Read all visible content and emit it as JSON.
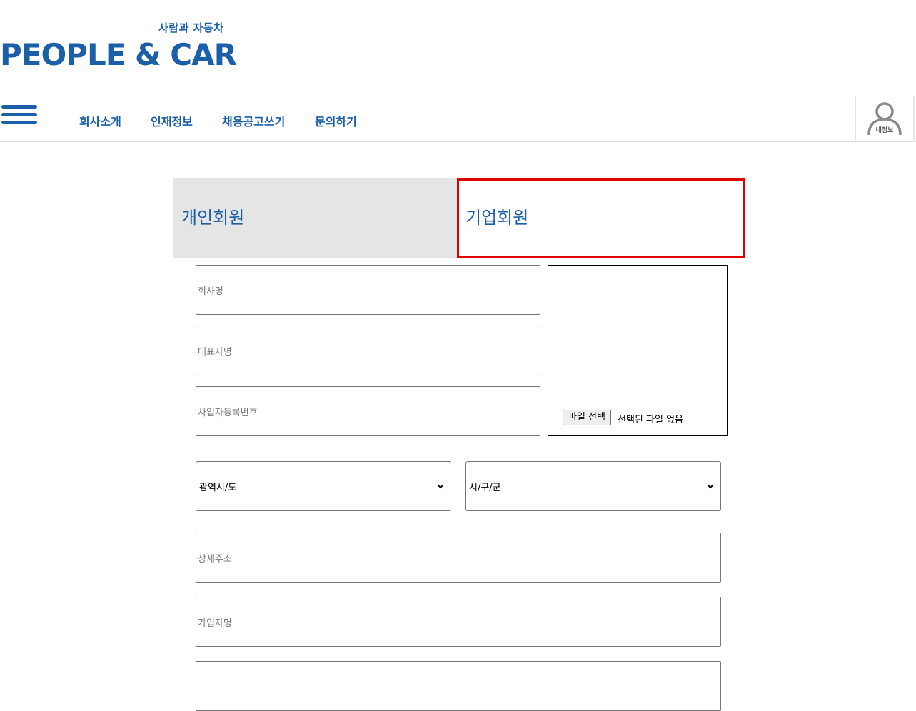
{
  "logo": {
    "tagline": "사람과 자동차",
    "name": "PEOPLE & CAR"
  },
  "nav": {
    "items": [
      {
        "label": "회사소개"
      },
      {
        "label": "인재정보"
      },
      {
        "label": "채용공고쓰기"
      },
      {
        "label": "문의하기"
      }
    ],
    "my_info_label": "내정보"
  },
  "tabs": {
    "personal": "개인회원",
    "company": "기업회원"
  },
  "form": {
    "company_name_placeholder": "회사명",
    "ceo_name_placeholder": "대표자명",
    "business_number_placeholder": "사업자등록번호",
    "file_button_label": "파일 선택",
    "file_status": "선택된 파일 없음",
    "province_select": "광역시/도",
    "city_select": "시/구/군",
    "address_detail_placeholder": "상세주소",
    "member_name_placeholder": "가입자명"
  },
  "colors": {
    "brand": "#1a5fa8",
    "active_tab_border": "#e00000",
    "inactive_tab_bg": "#e5e5e5"
  }
}
